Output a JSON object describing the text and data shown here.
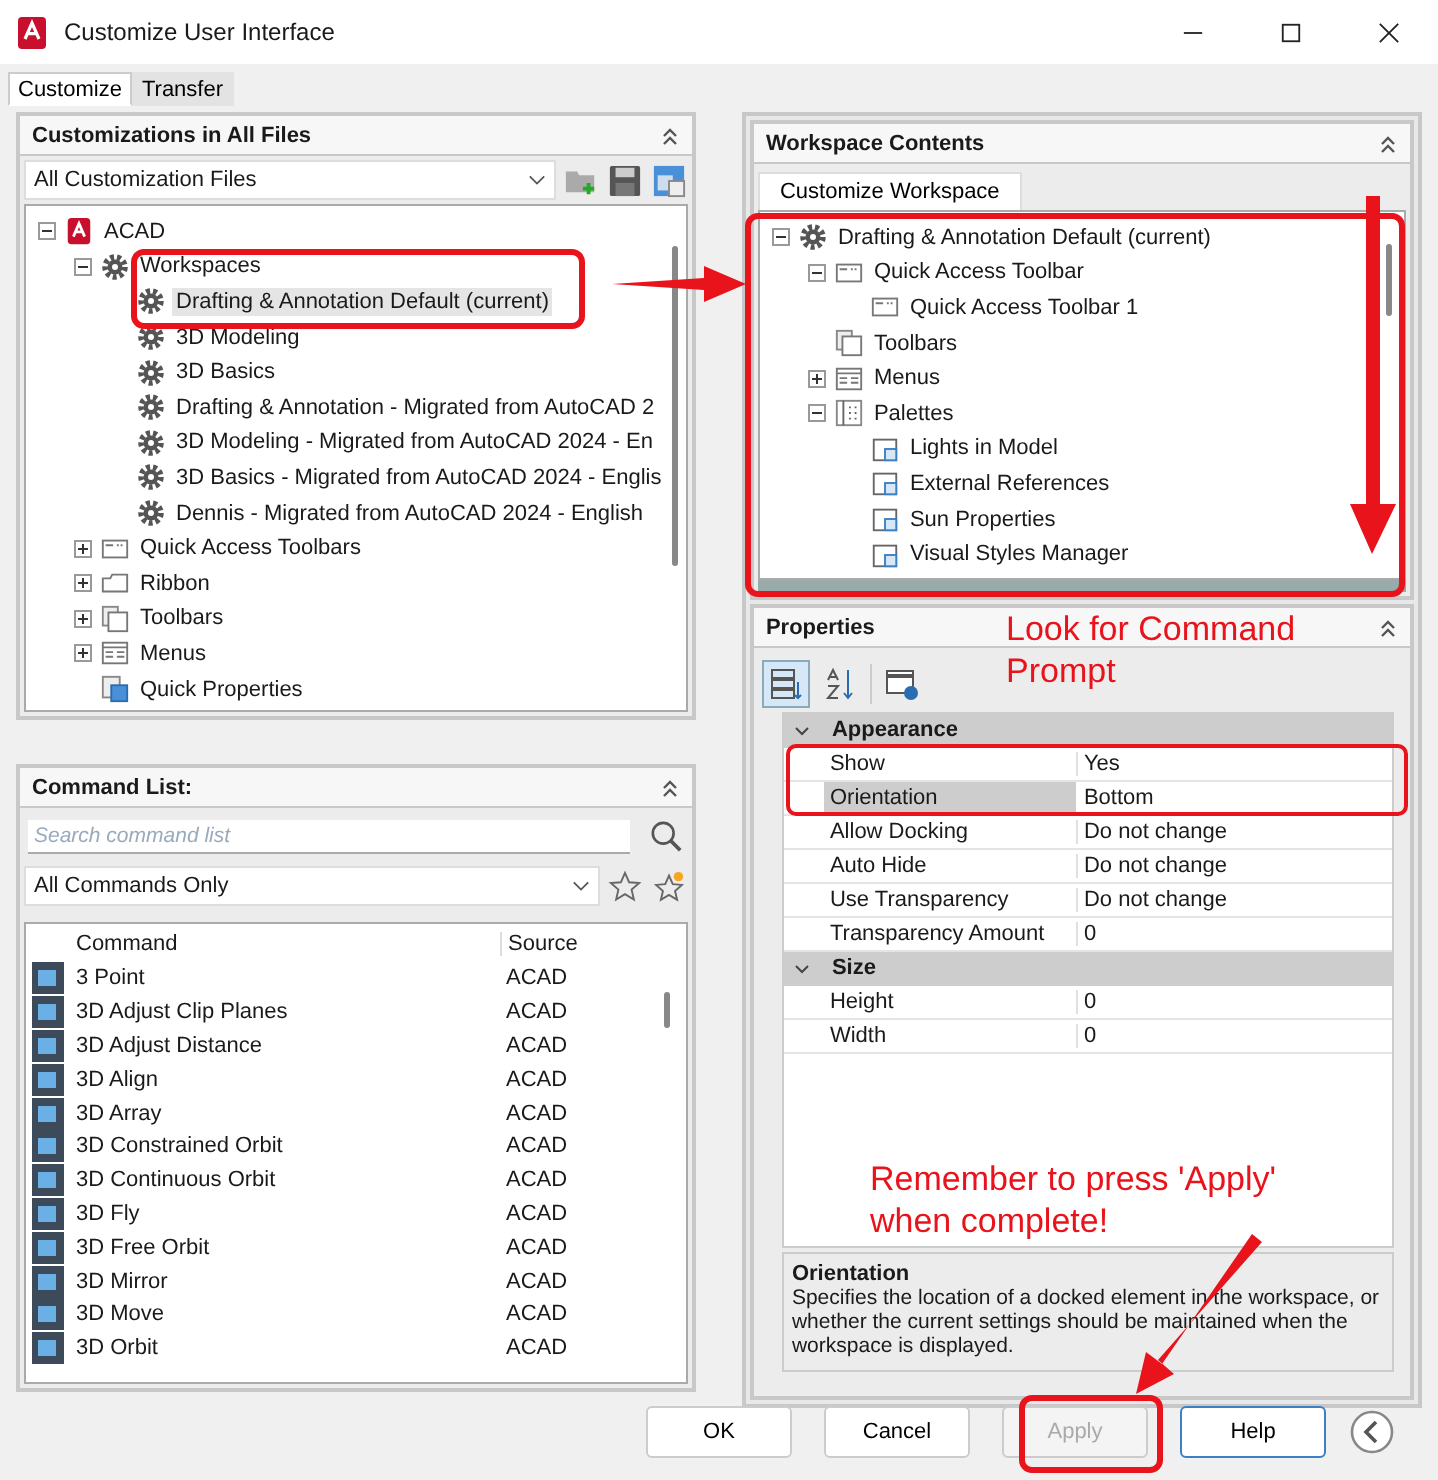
{
  "window": {
    "title": "Customize User Interface"
  },
  "tabs": [
    {
      "label": "Customize",
      "selected": true
    },
    {
      "label": "Transfer",
      "selected": false
    }
  ],
  "customizations_panel": {
    "title": "Customizations in All Files",
    "file_filter": "All Customization Files",
    "tree": [
      {
        "label": "ACAD",
        "kind": "app",
        "expanded": true,
        "selected": false,
        "children": [
          {
            "label": "Workspaces",
            "kind": "workspace",
            "expanded": true,
            "selected": false,
            "children": [
              {
                "label": "Drafting & Annotation Default (current)",
                "kind": "workspace",
                "selected": true
              },
              {
                "label": "3D Modeling",
                "kind": "workspace",
                "selected": false
              },
              {
                "label": "3D Basics",
                "kind": "workspace",
                "selected": false
              },
              {
                "label": "Drafting & Annotation - Migrated from AutoCAD 2",
                "kind": "workspace",
                "selected": false
              },
              {
                "label": "3D Modeling - Migrated from AutoCAD 2024 - En",
                "kind": "workspace",
                "selected": false
              },
              {
                "label": "3D Basics - Migrated from AutoCAD 2024 - Englis",
                "kind": "workspace",
                "selected": false
              },
              {
                "label": "Dennis - Migrated from AutoCAD 2024 - English",
                "kind": "workspace",
                "selected": false
              }
            ]
          },
          {
            "label": "Quick Access Toolbars",
            "kind": "toolbar",
            "expanded": false,
            "selected": false
          },
          {
            "label": "Ribbon",
            "kind": "ribbon",
            "expanded": false,
            "selected": false
          },
          {
            "label": "Toolbars",
            "kind": "toolbars",
            "expanded": false,
            "selected": false
          },
          {
            "label": "Menus",
            "kind": "menus",
            "expanded": false,
            "selected": false
          },
          {
            "label": "Quick Properties",
            "kind": "quickprops",
            "selected": false
          }
        ]
      }
    ]
  },
  "command_list": {
    "title": "Command List:",
    "search": {
      "placeholder": "Search command list"
    },
    "filter": "All Commands Only",
    "columns": [
      "Command",
      "Source"
    ],
    "rows": [
      {
        "command": "3 Point",
        "source": "ACAD"
      },
      {
        "command": "3D Adjust Clip Planes",
        "source": "ACAD"
      },
      {
        "command": "3D Adjust Distance",
        "source": "ACAD"
      },
      {
        "command": "3D Align",
        "source": "ACAD"
      },
      {
        "command": "3D Array",
        "source": "ACAD"
      },
      {
        "command": "3D Constrained Orbit",
        "source": "ACAD"
      },
      {
        "command": "3D Continuous Orbit",
        "source": "ACAD"
      },
      {
        "command": "3D Fly",
        "source": "ACAD"
      },
      {
        "command": "3D Free Orbit",
        "source": "ACAD"
      },
      {
        "command": "3D Mirror",
        "source": "ACAD"
      },
      {
        "command": "3D Move",
        "source": "ACAD"
      },
      {
        "command": "3D Orbit",
        "source": "ACAD"
      }
    ]
  },
  "workspace_contents": {
    "title": "Workspace Contents",
    "tab": "Customize Workspace",
    "tree": [
      {
        "label": "Drafting & Annotation Default (current)",
        "kind": "workspace",
        "expanded": true,
        "children": [
          {
            "label": "Quick Access Toolbar",
            "kind": "toolbar",
            "expanded": true,
            "children": [
              {
                "label": "Quick Access Toolbar 1",
                "kind": "toolbar"
              }
            ]
          },
          {
            "label": "Toolbars",
            "kind": "toolbars"
          },
          {
            "label": "Menus",
            "kind": "menus",
            "expanded": false
          },
          {
            "label": "Palettes",
            "kind": "palettes",
            "expanded": true,
            "children": [
              {
                "label": "Lights in Model",
                "kind": "palette"
              },
              {
                "label": "External References",
                "kind": "palette"
              },
              {
                "label": "Sun Properties",
                "kind": "palette"
              },
              {
                "label": "Visual Styles Manager",
                "kind": "palette"
              }
            ]
          }
        ]
      }
    ]
  },
  "properties": {
    "title": "Properties",
    "categories": [
      {
        "name": "Appearance",
        "expanded": true,
        "rows": [
          {
            "name": "Show",
            "value": "Yes",
            "selected": false
          },
          {
            "name": "Orientation",
            "value": "Bottom",
            "selected": true
          },
          {
            "name": "Allow Docking",
            "value": "Do not change",
            "selected": false
          },
          {
            "name": "Auto Hide",
            "value": "Do not change",
            "selected": false
          },
          {
            "name": "Use Transparency",
            "value": "Do not change",
            "selected": false
          },
          {
            "name": "Transparency Amount",
            "value": "0",
            "selected": false
          }
        ]
      },
      {
        "name": "Size",
        "expanded": true,
        "rows": [
          {
            "name": "Height",
            "value": "0",
            "selected": false
          },
          {
            "name": "Width",
            "value": "0",
            "selected": false
          }
        ]
      }
    ],
    "description": {
      "title": "Orientation",
      "text": "Specifies the location of a docked element in the workspace, or whether the current settings should be maintained when the workspace is displayed."
    }
  },
  "buttons": [
    {
      "label": "OK",
      "disabled": false,
      "focused": false
    },
    {
      "label": "Cancel",
      "disabled": false,
      "focused": false
    },
    {
      "label": "Apply",
      "disabled": true,
      "focused": false
    },
    {
      "label": "Help",
      "disabled": false,
      "focused": true
    }
  ],
  "annotations": [
    {
      "text": "Look for Command Prompt"
    },
    {
      "text": "Remember to press 'Apply' when complete!"
    }
  ]
}
